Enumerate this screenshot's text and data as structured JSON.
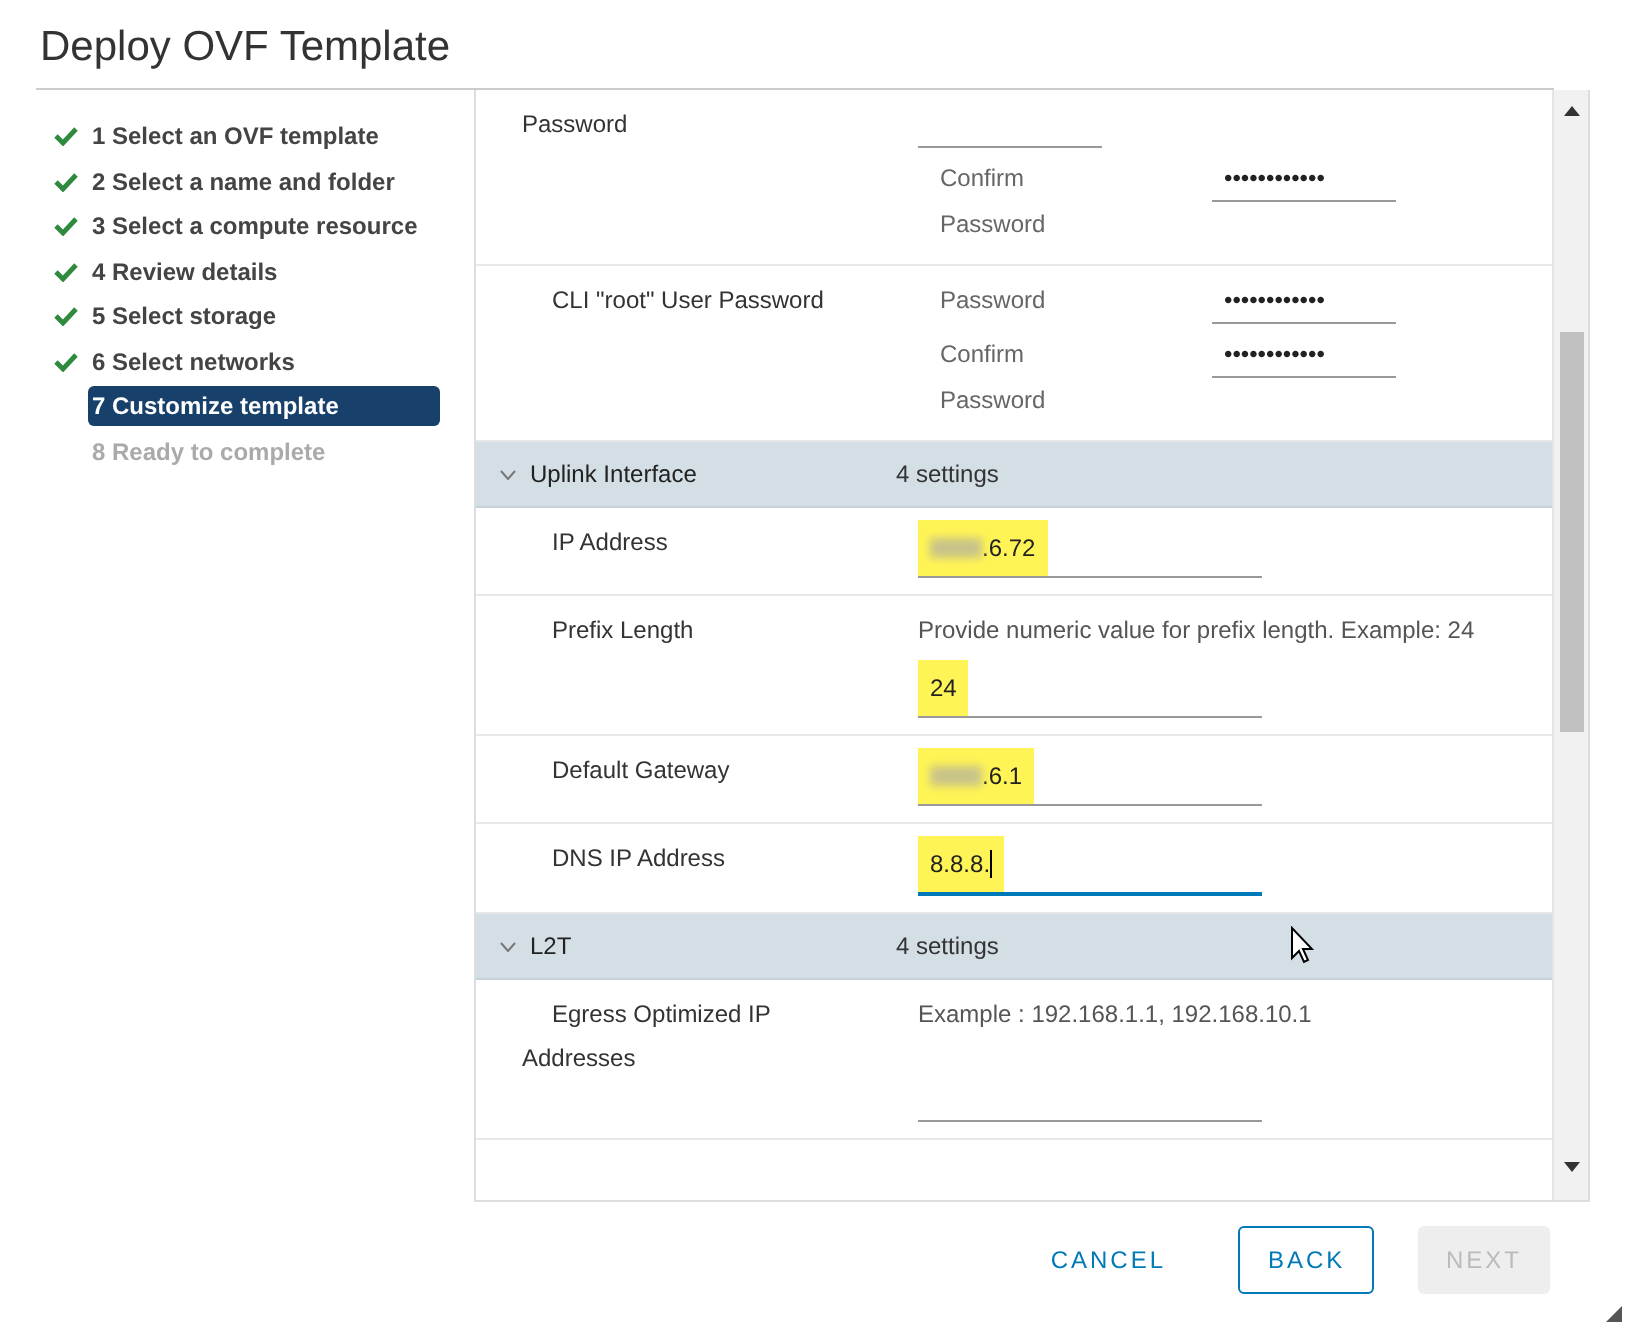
{
  "window": {
    "title": "Deploy OVF Template"
  },
  "steps": [
    {
      "label": "1 Select an OVF template",
      "done": true,
      "disabled": false,
      "selected": false
    },
    {
      "label": "2 Select a name and folder",
      "done": true,
      "disabled": false,
      "selected": false
    },
    {
      "label": "3 Select a compute resource",
      "done": true,
      "disabled": false,
      "selected": false
    },
    {
      "label": "4 Review details",
      "done": true,
      "disabled": false,
      "selected": false
    },
    {
      "label": "5 Select storage",
      "done": true,
      "disabled": false,
      "selected": false
    },
    {
      "label": "6 Select networks",
      "done": true,
      "disabled": false,
      "selected": false
    },
    {
      "label": "7 Customize template",
      "done": false,
      "disabled": false,
      "selected": true
    },
    {
      "label": "8 Ready to complete",
      "done": false,
      "disabled": true,
      "selected": false
    }
  ],
  "settings": [
    {
      "kind": "row",
      "label": "Password",
      "fields": [
        {
          "focused": false
        },
        {
          "label": "Confirm Password",
          "value": "••••••••••••"
        }
      ]
    },
    {
      "kind": "row",
      "label": "CLI \"root\" User Password",
      "fields": [
        {
          "label": "Password",
          "value": "••••••••••••"
        },
        {
          "label": "Confirm Password",
          "value": "••••••••••••"
        }
      ]
    },
    {
      "kind": "section",
      "label": "Uplink Interface",
      "count": "4 settings",
      "expanded": true
    },
    {
      "kind": "row",
      "label": "IP Address",
      "fields": [
        {
          "value": ".6.72",
          "redacted": true,
          "highlighted": true
        }
      ]
    },
    {
      "kind": "row",
      "label": "Prefix Length",
      "description": "Provide numeric value for prefix length. Example: 24",
      "fields": [
        {
          "value": "24",
          "highlighted": true
        }
      ]
    },
    {
      "kind": "row",
      "label": "Default Gateway",
      "fields": [
        {
          "value": ".6.1",
          "redacted": true,
          "highlighted": true
        }
      ]
    },
    {
      "kind": "row",
      "label": "DNS IP Address",
      "fields": [
        {
          "value": "8.8.8.",
          "highlighted": true,
          "focused": true
        }
      ]
    },
    {
      "kind": "section",
      "label": "L2T",
      "count": "4 settings",
      "expanded": true
    },
    {
      "kind": "row",
      "label": "Egress Optimized IP Addresses",
      "description": "Example : 192.168.1.1, 192.168.10.1",
      "fields": [
        {
          "focused": false
        }
      ]
    }
  ],
  "buttons": [
    {
      "label": "CANCEL",
      "kind": "link",
      "disabled": false
    },
    {
      "label": "BACK",
      "kind": "outline",
      "disabled": false
    },
    {
      "label": "NEXT",
      "kind": "primary",
      "disabled": true
    }
  ]
}
